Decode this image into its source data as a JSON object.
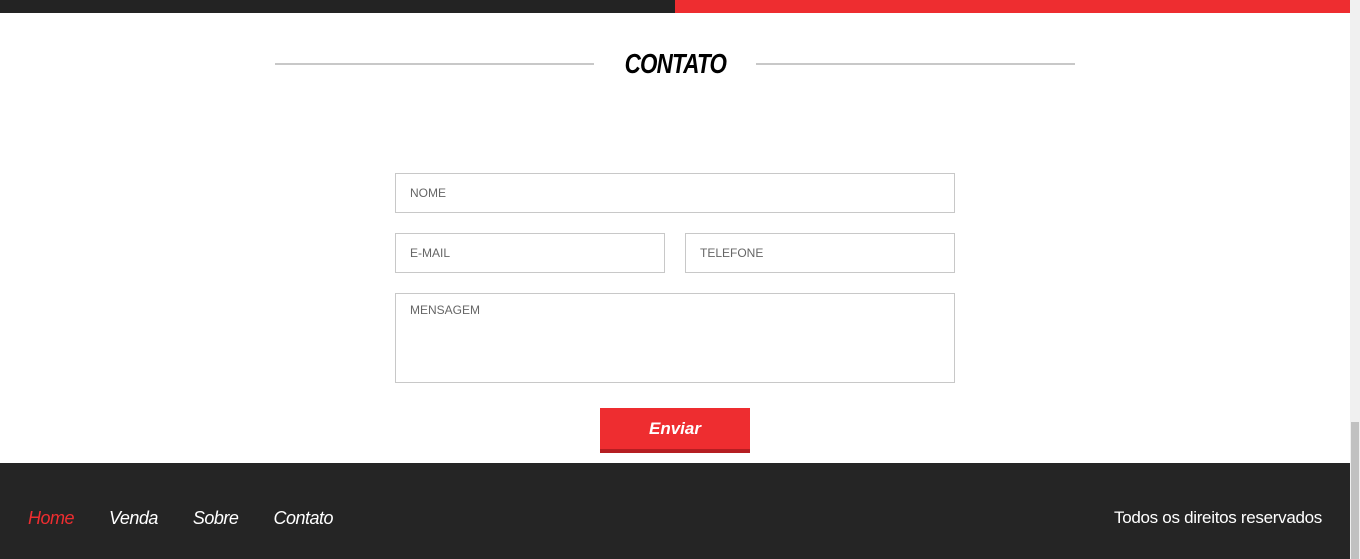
{
  "section": {
    "title": "CONTATO"
  },
  "form": {
    "name_placeholder": "NOME",
    "email_placeholder": "E-MAIL",
    "phone_placeholder": "TELEFONE",
    "message_placeholder": "MENSAGEM",
    "submit_label": "Enviar"
  },
  "footer": {
    "nav": [
      "Home",
      "Venda",
      "Sobre",
      "Contato"
    ],
    "rights": "Todos os direitos reservados"
  },
  "colors": {
    "accent": "#ee2d30",
    "dark": "#252525"
  }
}
